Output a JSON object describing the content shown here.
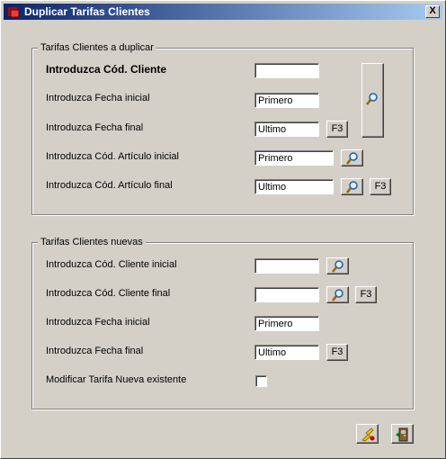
{
  "window": {
    "title": "Duplicar Tarifas Clientes",
    "close_label": "X"
  },
  "group1": {
    "legend": "Tarifas Clientes a duplicar",
    "cliente_label": "Introduzca Cód. Cliente",
    "cliente_value": "",
    "fecha_ini_label": "Introduzca Fecha inicial",
    "fecha_ini_value": "Primero",
    "fecha_fin_label": "Introduzca Fecha final",
    "fecha_fin_value": "Ultimo",
    "art_ini_label": "Introduzca Cód. Artículo inicial",
    "art_ini_value": "Primero",
    "art_fin_label": "Introduzca Cód. Artículo final",
    "art_fin_value": "Ultimo",
    "f3": "F3"
  },
  "group2": {
    "legend": "Tarifas Clientes nuevas",
    "cli_ini_label": "Introduzca Cód. Cliente inicial",
    "cli_ini_value": "",
    "cli_fin_label": "Introduzca Cód. Cliente final",
    "cli_fin_value": "",
    "fecha_ini_label": "Introduzca Fecha inicial",
    "fecha_ini_value": "Primero",
    "fecha_fin_label": "Introduzca Fecha final",
    "fecha_fin_value": "Ultimo",
    "modificar_label": "Modificar Tarifa Nueva existente",
    "modificar_checked": false,
    "f3": "F3"
  },
  "icons": {
    "search": "magnifier-icon",
    "accept": "run-icon",
    "exit": "exit-door-icon"
  }
}
